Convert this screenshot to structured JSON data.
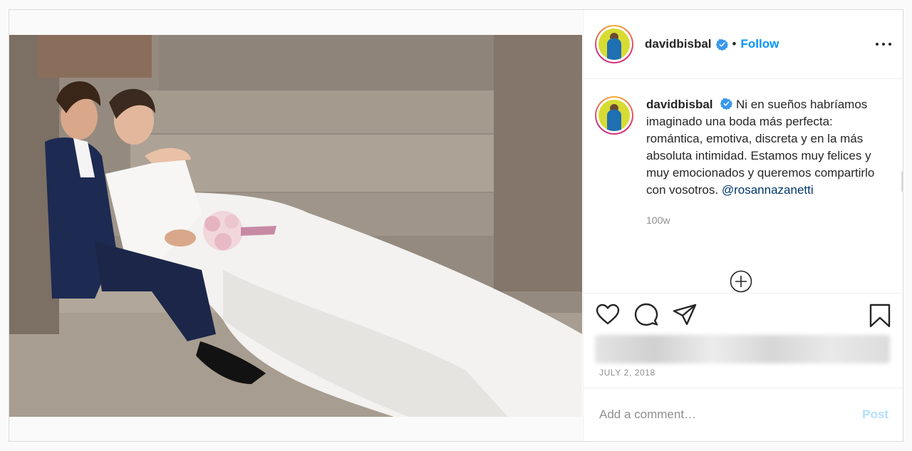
{
  "post": {
    "username": "davidbisbal",
    "separator": "•",
    "follow_label": "Follow",
    "caption_text": "Ni en sueños habríamos imaginado una boda más perfecta: romántica, emotiva, discreta y en la más absoluta intimidad. Estamos muy felices y muy emocionados y queremos compartirlo con vosotros.",
    "caption_mention": "@rosannazanetti",
    "caption_time": "100w",
    "date": "JULY 2, 2018",
    "comment_placeholder": "Add a comment…",
    "post_label": "Post"
  },
  "icons": [
    "more-options-icon",
    "verified-badge-icon",
    "load-more-comments-icon",
    "heart-icon",
    "comment-icon",
    "share-icon",
    "bookmark-icon"
  ],
  "colors": {
    "follow": "#0095f6",
    "post_disabled": "#b2dffc",
    "mention": "#00376b",
    "muted": "#8e8e8e",
    "text": "#262626"
  }
}
